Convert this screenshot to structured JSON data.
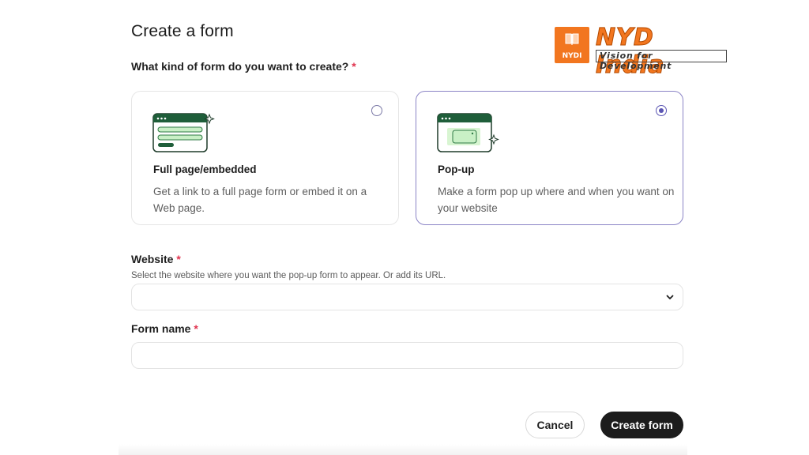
{
  "page": {
    "title": "Create a form"
  },
  "logo": {
    "name": "NYD India",
    "tagline": "Vision for Development",
    "box_text": "NYDI",
    "color": "#f2761f"
  },
  "form_type": {
    "question": "What kind of form do you want to create?",
    "required_mark": "*",
    "options": [
      {
        "title": "Full page/embedded",
        "description": "Get a link to a full page form or embed it on a Web page.",
        "selected": false,
        "icon": "full-page-form-illustration"
      },
      {
        "title": "Pop-up",
        "description": "Make a form pop up where and when you want on your website",
        "selected": true,
        "icon": "popup-form-illustration"
      }
    ]
  },
  "website": {
    "label": "Website",
    "required_mark": "*",
    "help": "Select the website where you want the pop-up form to appear. Or add its URL.",
    "value": "",
    "icon": "chevron-down-icon"
  },
  "form_name": {
    "label": "Form name",
    "required_mark": "*",
    "value": ""
  },
  "actions": {
    "cancel": "Cancel",
    "create": "Create form"
  },
  "colors": {
    "accent": "#5b55b3",
    "brand_green": "#1f5e3a",
    "primary_button": "#1c1c1c",
    "required": "#e0344f"
  }
}
